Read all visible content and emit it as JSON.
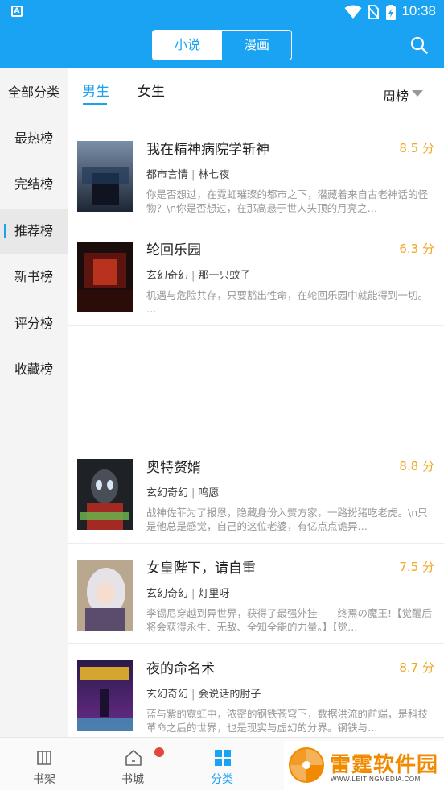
{
  "status_bar": {
    "time": "10:38",
    "icons": [
      "app-notification-icon",
      "wifi-icon",
      "no-sim-icon",
      "battery-charging-icon"
    ]
  },
  "header": {
    "tabs": [
      {
        "label": "小说",
        "active": true
      },
      {
        "label": "漫画",
        "active": false
      }
    ],
    "search_icon": "search-icon"
  },
  "sidebar": {
    "items": [
      {
        "label": "全部分类",
        "active": false
      },
      {
        "label": "最热榜",
        "active": false
      },
      {
        "label": "完结榜",
        "active": false
      },
      {
        "label": "推荐榜",
        "active": true
      },
      {
        "label": "新书榜",
        "active": false
      },
      {
        "label": "评分榜",
        "active": false
      },
      {
        "label": "收藏榜",
        "active": false
      }
    ]
  },
  "filter": {
    "genders": [
      {
        "label": "男生",
        "active": true
      },
      {
        "label": "女生",
        "active": false
      }
    ],
    "period": "周榜"
  },
  "books": [
    {
      "title": "我在精神病院学斩神",
      "score": "8.5 分",
      "category": "都市言情",
      "author": "林七夜",
      "desc": "你是否想过，在霓虹璀璨的都市之下，潜藏着来自古老神话的怪物？\\n你是否想过，在那高悬于世人头顶的月亮之…",
      "cover_text": "精神病院学斩神"
    },
    {
      "title": "轮回乐园",
      "score": "6.3 分",
      "category": "玄幻奇幻",
      "author": "那一只蚊子",
      "desc": "机遇与危险共存，只要豁出性命，在轮回乐园中就能得到一切。 …",
      "cover_text": "轮回乐园"
    },
    {
      "title": "奥特赘婿",
      "score": "8.8 分",
      "category": "玄幻奇幻",
      "author": "鸣愿",
      "desc": "战神佐菲为了报恩，隐藏身份入赘方家，一路扮猪吃老虎。\\n只是他总是感觉，自己的这位老婆，有亿点点诡异…",
      "cover_text": "奥特赘婿"
    },
    {
      "title": "女皇陛下，请自重",
      "score": "7.5 分",
      "category": "玄幻奇幻",
      "author": "灯里呀",
      "desc": "李锡尼穿越到异世界，获得了最强外挂——终焉の魔王!【觉醒后将会获得永生、无敌、全知全能的力量。】【觉…",
      "cover_text": ""
    },
    {
      "title": "夜的命名术",
      "score": "8.7 分",
      "category": "玄幻奇幻",
      "author": "会说话的肘子",
      "desc": "蓝与紫的霓虹中，浓密的钢铁苍穹下，数据洪流的前端，是科技革命之后的世界，也是现实与虚幻的分界。钢铁与…",
      "cover_text": "夜的命名术"
    }
  ],
  "bottom_nav": [
    {
      "label": "书架",
      "icon": "bookshelf-icon",
      "active": false
    },
    {
      "label": "书城",
      "icon": "home-icon",
      "active": false,
      "badge": true
    },
    {
      "label": "分类",
      "icon": "category-grid-icon",
      "active": true
    }
  ],
  "watermark": {
    "cn": "雷霆软件园",
    "en": "WWW.LEITINGMEDIA.COM"
  },
  "colors": {
    "primary": "#1aa3f3",
    "score": "#f2a623",
    "badge": "#e0493b",
    "watermark": "#f08a00"
  }
}
